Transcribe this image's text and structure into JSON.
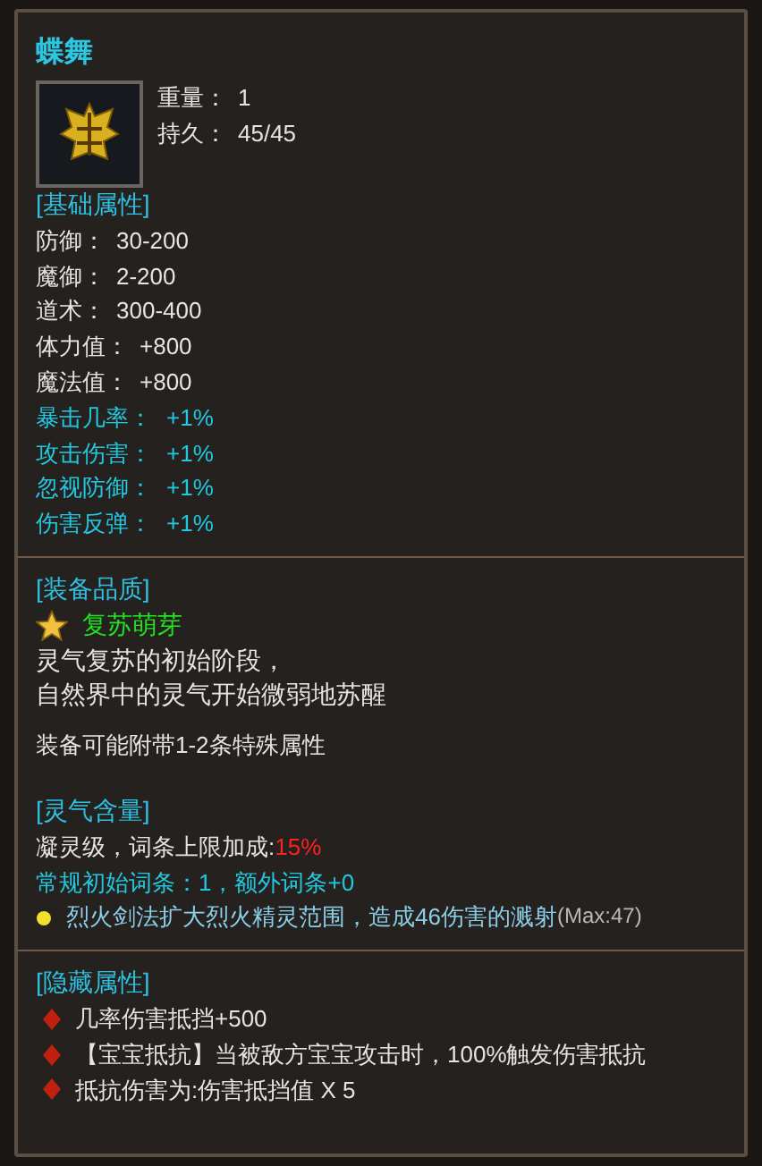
{
  "title": "蝶舞",
  "item_stats": [
    {
      "label": "重量：",
      "value": "1"
    },
    {
      "label": "持久：",
      "value": "45/45"
    }
  ],
  "basic": {
    "heading": "[基础属性]",
    "rows": [
      {
        "label": "防御：",
        "value": "30-200",
        "kind": "normal"
      },
      {
        "label": "魔御：",
        "value": "2-200",
        "kind": "normal"
      },
      {
        "label": "道术：",
        "value": "300-400",
        "kind": "normal"
      },
      {
        "label": "体力值：",
        "value": "+800",
        "kind": "normal"
      },
      {
        "label": "魔法值：",
        "value": "+800",
        "kind": "normal"
      },
      {
        "label": "暴击几率：",
        "value": "+1%",
        "kind": "special"
      },
      {
        "label": "攻击伤害：",
        "value": "+1%",
        "kind": "special"
      },
      {
        "label": "忽视防御：",
        "value": "+1%",
        "kind": "special"
      },
      {
        "label": "伤害反弹：",
        "value": "+1%",
        "kind": "special"
      }
    ]
  },
  "quality": {
    "heading": "[装备品质]",
    "grade": "复苏萌芽",
    "description": [
      "灵气复苏的初始阶段，",
      "自然界中的灵气开始微弱地苏醒"
    ],
    "note": "装备可能附带1-2条特殊属性"
  },
  "aura": {
    "heading": "[灵气含量]",
    "level_label": "凝灵级，词条上限加成:",
    "level_value": "15%",
    "affix_summary": "常规初始词条：1，额外词条+0",
    "affixes": [
      {
        "text": "烈火剑法扩大烈火精灵范围，造成46伤害的溅射",
        "max": "(Max:47)"
      }
    ]
  },
  "hidden": {
    "heading": "[隐藏属性]",
    "items": [
      "几率伤害抵挡+500",
      "【宝宝抵抗】当被敌方宝宝攻击时，100%触发伤害抵抗",
      "抵抗伤害为:伤害抵挡值 X 5"
    ]
  }
}
